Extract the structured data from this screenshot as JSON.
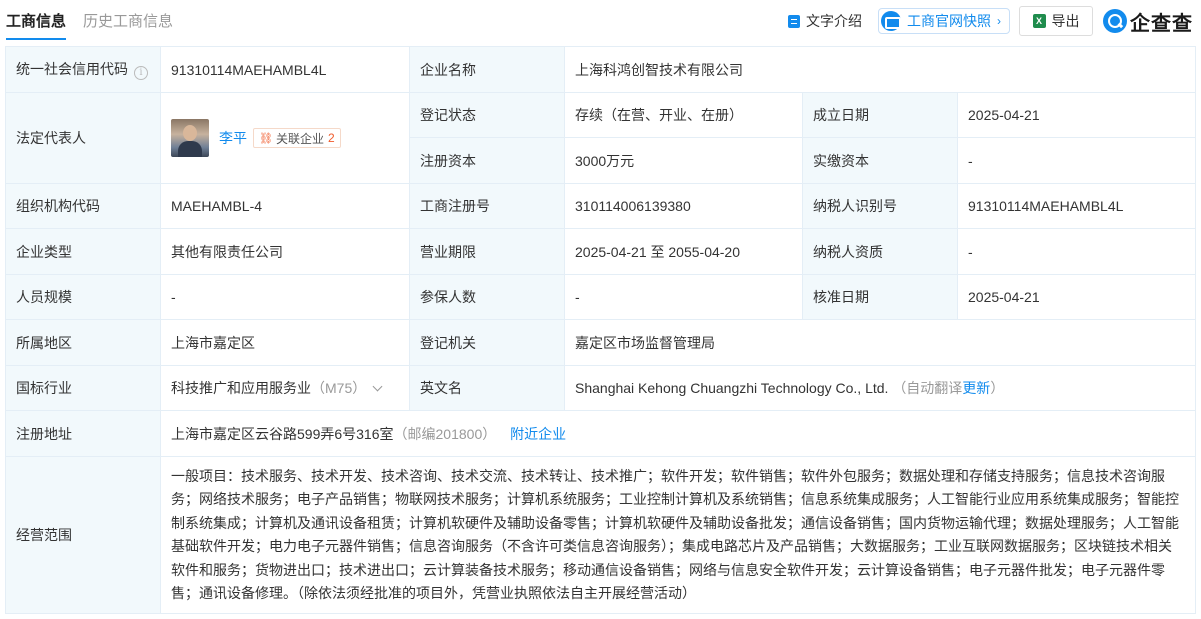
{
  "tabs": {
    "active": "工商信息",
    "inactive": "历史工商信息"
  },
  "toolbar": {
    "intro": "文字介绍",
    "snapshot": "工商官网快照",
    "export": "导出",
    "logo": "企查查"
  },
  "rows": {
    "credit_code": {
      "label": "统一社会信用代码",
      "value": "91310114MAEHAMBL4L"
    },
    "company_name": {
      "label": "企业名称",
      "value": "上海科鸿创智技术有限公司"
    },
    "legal_rep": {
      "label": "法定代表人",
      "name": "李平",
      "related_label": "关联企业",
      "related_count": "2"
    },
    "reg_status": {
      "label": "登记状态",
      "value": "存续（在营、开业、在册）"
    },
    "established": {
      "label": "成立日期",
      "value": "2025-04-21"
    },
    "reg_capital": {
      "label": "注册资本",
      "value": "3000万元"
    },
    "paid_capital": {
      "label": "实缴资本",
      "value": "-"
    },
    "org_code": {
      "label": "组织机构代码",
      "value": "MAEHAMBL-4"
    },
    "reg_no": {
      "label": "工商注册号",
      "value": "310114006139380"
    },
    "taxpayer_id": {
      "label": "纳税人识别号",
      "value": "91310114MAEHAMBL4L"
    },
    "company_type": {
      "label": "企业类型",
      "value": "其他有限责任公司"
    },
    "biz_term": {
      "label": "营业期限",
      "value": "2025-04-21 至 2055-04-20"
    },
    "taxpayer_qual": {
      "label": "纳税人资质",
      "value": "-"
    },
    "staff_size": {
      "label": "人员规模",
      "value": "-"
    },
    "insured": {
      "label": "参保人数",
      "value": "-"
    },
    "approved_date": {
      "label": "核准日期",
      "value": "2025-04-21"
    },
    "region": {
      "label": "所属地区",
      "value": "上海市嘉定区"
    },
    "reg_authority": {
      "label": "登记机关",
      "value": "嘉定区市场监督管理局"
    },
    "industry": {
      "label": "国标行业",
      "value": "科技推广和应用服务业",
      "code": "（M75）"
    },
    "english_name": {
      "label": "英文名",
      "value": "Shanghai Kehong Chuangzhi Technology Co., Ltd.",
      "auto_note": "（自动翻译",
      "update": "更新",
      "close_paren": "）"
    },
    "address": {
      "label": "注册地址",
      "value": "上海市嘉定区云谷路599弄6号316室",
      "postcode": "（邮编201800）",
      "nearby": "附近企业"
    },
    "scope": {
      "label": "经营范围",
      "value": "一般项目：技术服务、技术开发、技术咨询、技术交流、技术转让、技术推广；软件开发；软件销售；软件外包服务；数据处理和存储支持服务；信息技术咨询服务；网络技术服务；电子产品销售；物联网技术服务；计算机系统服务；工业控制计算机及系统销售；信息系统集成服务；人工智能行业应用系统集成服务；智能控制系统集成；计算机及通讯设备租赁；计算机软硬件及辅助设备零售；计算机软硬件及辅助设备批发；通信设备销售；国内货物运输代理；数据处理服务；人工智能基础软件开发；电力电子元器件销售；信息咨询服务（不含许可类信息咨询服务）；集成电路芯片及产品销售；大数据服务；工业互联网数据服务；区块链技术相关软件和服务；货物进出口；技术进出口；云计算装备技术服务；移动通信设备销售；网络与信息安全软件开发；云计算设备销售；电子元器件批发；电子元器件零售；通讯设备修理。（除依法须经批准的项目外，凭营业执照依法自主开展经营活动）"
    }
  }
}
